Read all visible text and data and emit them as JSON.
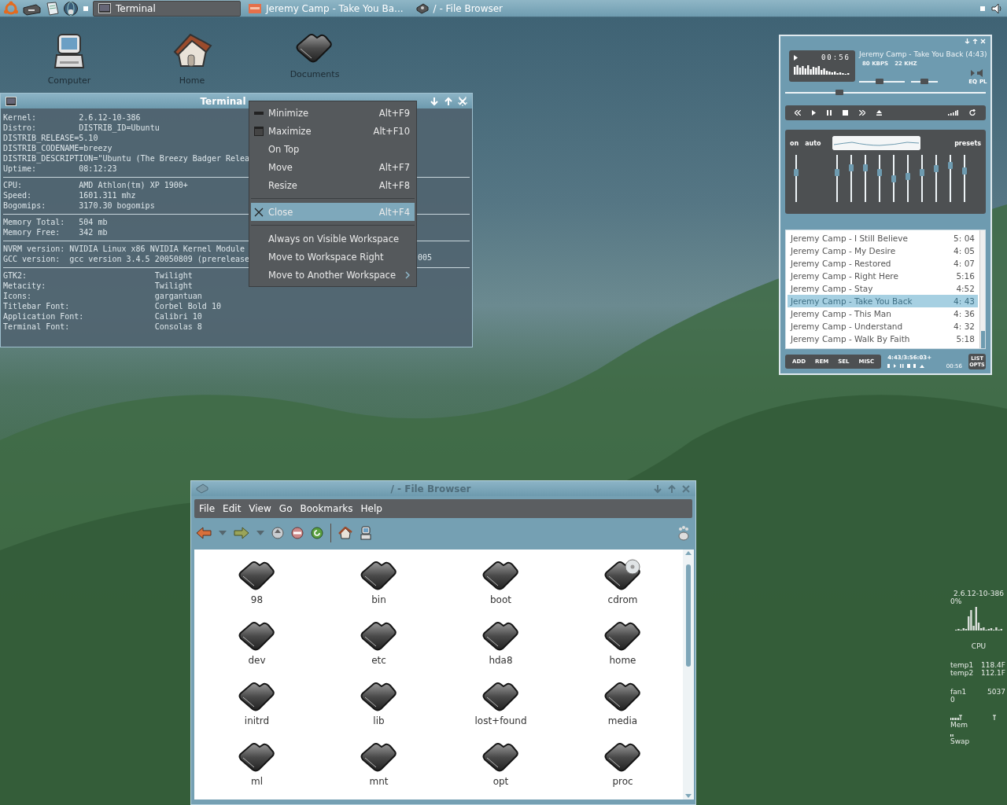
{
  "panel": {
    "tasks": [
      {
        "title": "Terminal",
        "selected": true,
        "kind": "terminal"
      },
      {
        "title": "Jeremy Camp - Take You Ba...",
        "selected": false,
        "kind": "player"
      },
      {
        "title": "/ - File Browser",
        "selected": false,
        "kind": "browser"
      }
    ]
  },
  "desktop_icons": [
    {
      "label": "Computer",
      "kind": "computer"
    },
    {
      "label": "Home",
      "kind": "home"
    },
    {
      "label": "Documents",
      "kind": "folder"
    }
  ],
  "terminal": {
    "title": "Terminal",
    "sections": [
      [
        "Kernel:         2.6.12-10-386",
        "Distro:         DISTRIB_ID=Ubuntu",
        "DISTRIB_RELEASE=5.10",
        "DISTRIB_CODENAME=breezy",
        "DISTRIB_DESCRIPTION=\"Ubuntu (The Breezy Badger Relea",
        "Uptime:         08:12:23"
      ],
      [
        "CPU:            AMD Athlon(tm) XP 1900+",
        "Speed:          1601.311 mhz",
        "Bogomips:       3170.30 bogomips"
      ],
      [
        "Memory Total:   504 mb",
        "Memory Free:    342 mb"
      ],
      [
        "NVRM version: NVIDIA Linux x86 NVIDIA Kernel Module",
        "GCC version:  gcc version 3.4.5 20050809 (prerelease"
      ],
      [
        "GTK2:                           Twilight",
        "Metacity:                       Twilight",
        "Icons:                          gargantuan",
        "Titlebar Font:                  Corbel Bold 10",
        "Application Font:               Calibri 10",
        "Terminal Font:                  Consolas 8"
      ]
    ],
    "overflow_text": "005"
  },
  "window_menu": [
    {
      "kind": "minimize",
      "label": "Minimize",
      "shortcut": "Alt+F9",
      "selected": false
    },
    {
      "kind": "maximize",
      "label": "Maximize",
      "shortcut": "Alt+F10",
      "selected": false
    },
    {
      "kind": "item",
      "label": "On Top",
      "selected": false
    },
    {
      "kind": "item",
      "label": "Move",
      "shortcut": "Alt+F7",
      "selected": false
    },
    {
      "kind": "item",
      "label": "Resize",
      "shortcut": "Alt+F8",
      "selected": false
    },
    {
      "kind": "separator"
    },
    {
      "kind": "close",
      "label": "Close",
      "shortcut": "Alt+F4",
      "selected": true
    },
    {
      "kind": "separator"
    },
    {
      "kind": "item",
      "label": "Always on Visible Workspace",
      "selected": false
    },
    {
      "kind": "item",
      "label": "Move to Workspace Right",
      "selected": false
    },
    {
      "kind": "submenu",
      "label": "Move to Another Workspace",
      "selected": false
    }
  ],
  "player": {
    "time": "00:56",
    "song": "Jeremy Camp - Take You Back (4:43)",
    "bitrate": "80 KBPS",
    "samplerate": "22 KHZ",
    "eq_button": "EQ",
    "pl_button": "PL",
    "volume": {
      "level": 0.43
    },
    "balance": {
      "level": 0.52
    },
    "seek": {
      "level": 0.26
    },
    "equalizer": {
      "on_label": "on",
      "auto_label": "auto",
      "presets_label": "presets",
      "preamp": {
        "level": 0.62
      },
      "bands": [
        {
          "level": 0.62
        },
        {
          "level": 0.72
        },
        {
          "level": 0.72
        },
        {
          "level": 0.62
        },
        {
          "level": 0.48
        },
        {
          "level": 0.53
        },
        {
          "level": 0.62
        },
        {
          "level": 0.7
        },
        {
          "level": 0.76
        },
        {
          "level": 0.65
        }
      ]
    },
    "playlist": {
      "tracks": [
        {
          "title": "Jeremy Camp - I Still Believe",
          "duration": "5: 04",
          "selected": false
        },
        {
          "title": "Jeremy Camp - My Desire",
          "duration": "4: 05",
          "selected": false
        },
        {
          "title": "Jeremy Camp - Restored",
          "duration": "4: 07",
          "selected": false
        },
        {
          "title": "Jeremy Camp - Right Here",
          "duration": "5:16",
          "selected": false
        },
        {
          "title": "Jeremy Camp - Stay",
          "duration": "4:52",
          "selected": false
        },
        {
          "title": "Jeremy Camp - Take You Back",
          "duration": "4: 43",
          "selected": true
        },
        {
          "title": "Jeremy Camp - This Man",
          "duration": "4: 36",
          "selected": false
        },
        {
          "title": "Jeremy Camp - Understand",
          "duration": "4: 32",
          "selected": false
        },
        {
          "title": "Jeremy Camp - Walk By Faith",
          "duration": "5:18",
          "selected": false
        }
      ],
      "buttons": [
        "ADD",
        "REM",
        "SEL",
        "MISC"
      ],
      "total_time": "4:43/3:56:03+",
      "elapsed": "00:56",
      "options_button": "LIST OPTS"
    }
  },
  "file_browser": {
    "title": "/ - File Browser",
    "menus": [
      "File",
      "Edit",
      "View",
      "Go",
      "Bookmarks",
      "Help"
    ],
    "items": [
      {
        "name": "98",
        "kind": "folder"
      },
      {
        "name": "bin",
        "kind": "folder"
      },
      {
        "name": "boot",
        "kind": "folder"
      },
      {
        "name": "cdrom",
        "kind": "cdrom"
      },
      {
        "name": "dev",
        "kind": "folder"
      },
      {
        "name": "etc",
        "kind": "folder"
      },
      {
        "name": "hda8",
        "kind": "folder"
      },
      {
        "name": "home",
        "kind": "folder"
      },
      {
        "name": "initrd",
        "kind": "folder"
      },
      {
        "name": "lib",
        "kind": "folder"
      },
      {
        "name": "lost+found",
        "kind": "folder"
      },
      {
        "name": "media",
        "kind": "folder"
      },
      {
        "name": "ml",
        "kind": "folder"
      },
      {
        "name": "mnt",
        "kind": "folder"
      },
      {
        "name": "opt",
        "kind": "folder"
      },
      {
        "name": "proc",
        "kind": "folder"
      }
    ]
  },
  "system_monitor": {
    "kernel": "2.6.12-10-386",
    "cpu_percent": "0%",
    "cpu_label": "CPU",
    "sensors": [
      {
        "name": "temp1",
        "value": "118.4F"
      },
      {
        "name": "temp2",
        "value": "112.1F"
      }
    ],
    "fan": {
      "name": "fan1",
      "value": "5037"
    },
    "fan_extra": "0",
    "mem_label": "Mem",
    "swap_label": "Swap"
  }
}
